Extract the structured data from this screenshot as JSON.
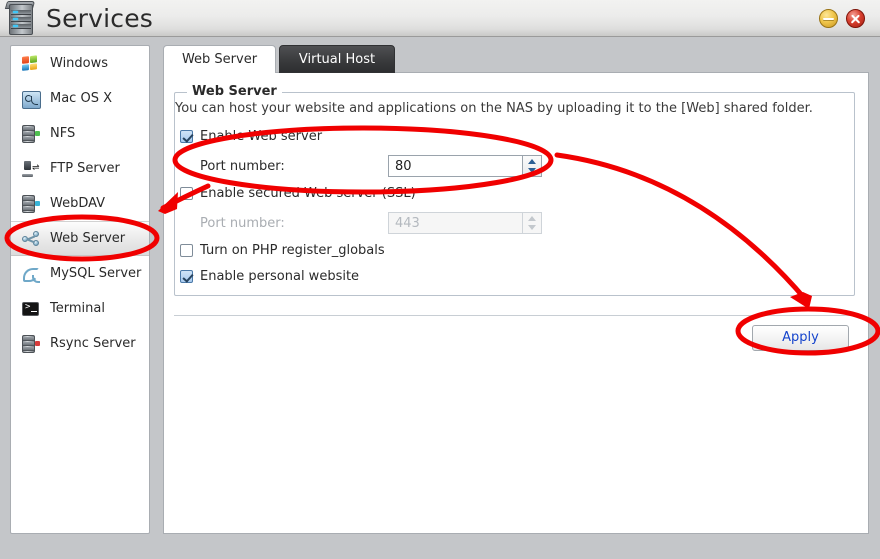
{
  "window": {
    "title": "Services",
    "app_icon": "nas-server-icon",
    "minimize_label": "Minimize",
    "close_label": "Close"
  },
  "sidebar": {
    "items": [
      {
        "label": "Windows",
        "icon": "windows-logo-icon",
        "selected": false
      },
      {
        "label": "Mac OS X",
        "icon": "finder-face-icon",
        "selected": false
      },
      {
        "label": "NFS",
        "icon": "disk-stack-icon",
        "selected": false
      },
      {
        "label": "FTP Server",
        "icon": "ftp-transfer-icon",
        "selected": false
      },
      {
        "label": "WebDAV",
        "icon": "disk-stack-icon",
        "selected": false
      },
      {
        "label": "Web Server",
        "icon": "network-nodes-icon",
        "selected": true
      },
      {
        "label": "MySQL Server",
        "icon": "dolphin-icon",
        "selected": false
      },
      {
        "label": "Terminal",
        "icon": "console-icon",
        "selected": false
      },
      {
        "label": "Rsync Server",
        "icon": "disk-stack-icon",
        "selected": false
      }
    ]
  },
  "tabs": [
    {
      "label": "Web Server",
      "active": true
    },
    {
      "label": "Virtual Host",
      "active": false
    }
  ],
  "main": {
    "fieldset_legend": "Web Server",
    "description": "You can host your website and applications on the NAS by uploading it to the [Web] shared folder.",
    "options": {
      "enable_web_server": {
        "label": "Enable Web server",
        "checked": true,
        "port_label": "Port number:",
        "port_value": "80",
        "port_disabled": false
      },
      "enable_ssl_web_server": {
        "label": "Enable secured Web server (SSL)",
        "checked": false,
        "port_label": "Port number:",
        "port_value": "443",
        "port_disabled": true
      },
      "php_register_globals": {
        "label": "Turn on PHP register_globals",
        "checked": false
      },
      "personal_website": {
        "label": "Enable personal website",
        "checked": true
      }
    },
    "apply_label": "Apply"
  },
  "annotations": {
    "color": "#f00000",
    "shapes": [
      "ellipse-around-web-server-sidebar-item",
      "ellipse-around-enable-web-server-and-port",
      "ellipse-around-apply-button",
      "arrow-from-options-to-sidebar",
      "arrow-from-options-to-apply"
    ]
  }
}
